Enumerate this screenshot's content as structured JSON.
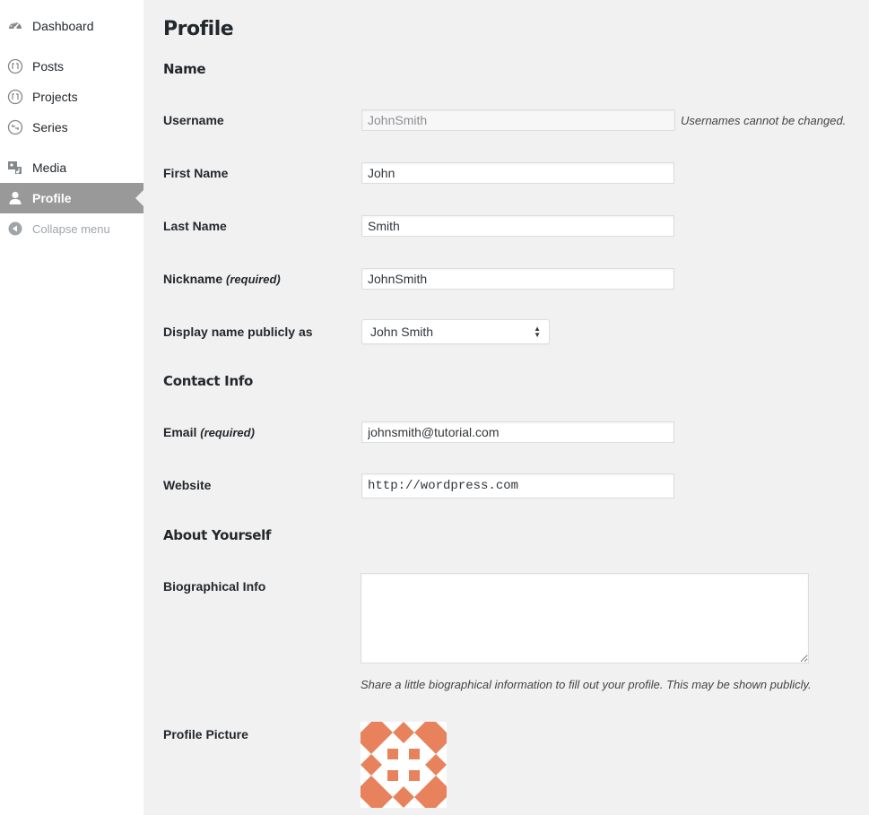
{
  "sidebar": {
    "items": [
      {
        "label": "Dashboard",
        "icon": "dashboard-icon"
      },
      {
        "label": "Posts",
        "icon": "posts-icon"
      },
      {
        "label": "Projects",
        "icon": "projects-icon"
      },
      {
        "label": "Series",
        "icon": "series-icon"
      },
      {
        "label": "Media",
        "icon": "media-icon"
      },
      {
        "label": "Profile",
        "icon": "user-icon",
        "current": true
      },
      {
        "label": "Collapse menu",
        "icon": "collapse-icon"
      }
    ]
  },
  "page": {
    "title": "Profile"
  },
  "sections": {
    "name": "Name",
    "contact": "Contact Info",
    "about": "About Yourself"
  },
  "fields": {
    "username": {
      "label": "Username",
      "value": "JohnSmith",
      "note": "Usernames cannot be changed."
    },
    "first_name": {
      "label": "First Name",
      "value": "John"
    },
    "last_name": {
      "label": "Last Name",
      "value": "Smith"
    },
    "nickname": {
      "label": "Nickname",
      "required": "(required)",
      "value": "JohnSmith"
    },
    "display_name": {
      "label": "Display name publicly as",
      "selected": "John Smith"
    },
    "email": {
      "label": "Email",
      "required": "(required)",
      "value": "johnsmith@tutorial.com"
    },
    "website": {
      "label": "Website",
      "value": "http://wordpress.com"
    },
    "bio": {
      "label": "Biographical Info",
      "value": "",
      "description": "Share a little biographical information to fill out your profile. This may be shown publicly."
    },
    "profile_picture": {
      "label": "Profile Picture",
      "icon": "identicon-avatar"
    }
  },
  "colors": {
    "sidebar_current_bg": "#999999",
    "avatar_fill": "#e8825c",
    "background": "#f1f1f1"
  }
}
